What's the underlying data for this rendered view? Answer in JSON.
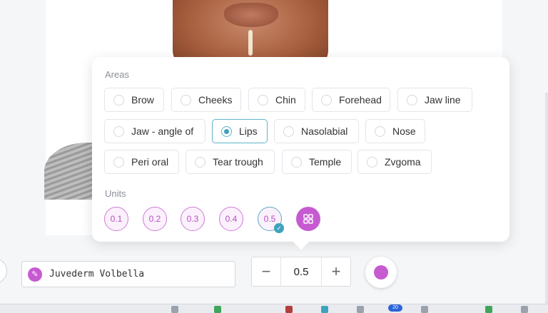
{
  "popup": {
    "areas_label": "Areas",
    "areas": [
      {
        "label": "Brow",
        "selected": false
      },
      {
        "label": "Cheeks",
        "selected": false
      },
      {
        "label": "Chin",
        "selected": false
      },
      {
        "label": "Forehead",
        "selected": false
      },
      {
        "label": "Jaw line",
        "selected": false
      },
      {
        "label": "Jaw - angle of",
        "selected": false
      },
      {
        "label": "Lips",
        "selected": true
      },
      {
        "label": "Nasolabial",
        "selected": false
      },
      {
        "label": "Nose",
        "selected": false
      },
      {
        "label": "Peri oral",
        "selected": false
      },
      {
        "label": "Tear trough",
        "selected": false
      },
      {
        "label": "Temple",
        "selected": false
      },
      {
        "label": "Zvgoma",
        "selected": false
      }
    ],
    "units_label": "Units",
    "units": [
      "0.1",
      "0.2",
      "0.3",
      "0.4",
      "0.5"
    ],
    "selected_unit": "0.5"
  },
  "product": {
    "name": "Juvederm Volbella",
    "icon": "syringe-icon"
  },
  "stepper": {
    "value": "0.5",
    "minus": "−",
    "plus": "+"
  },
  "taskbar": {
    "badge": "20"
  },
  "colors": {
    "accent": "#c65bd1",
    "selected": "#3fa2bd"
  }
}
